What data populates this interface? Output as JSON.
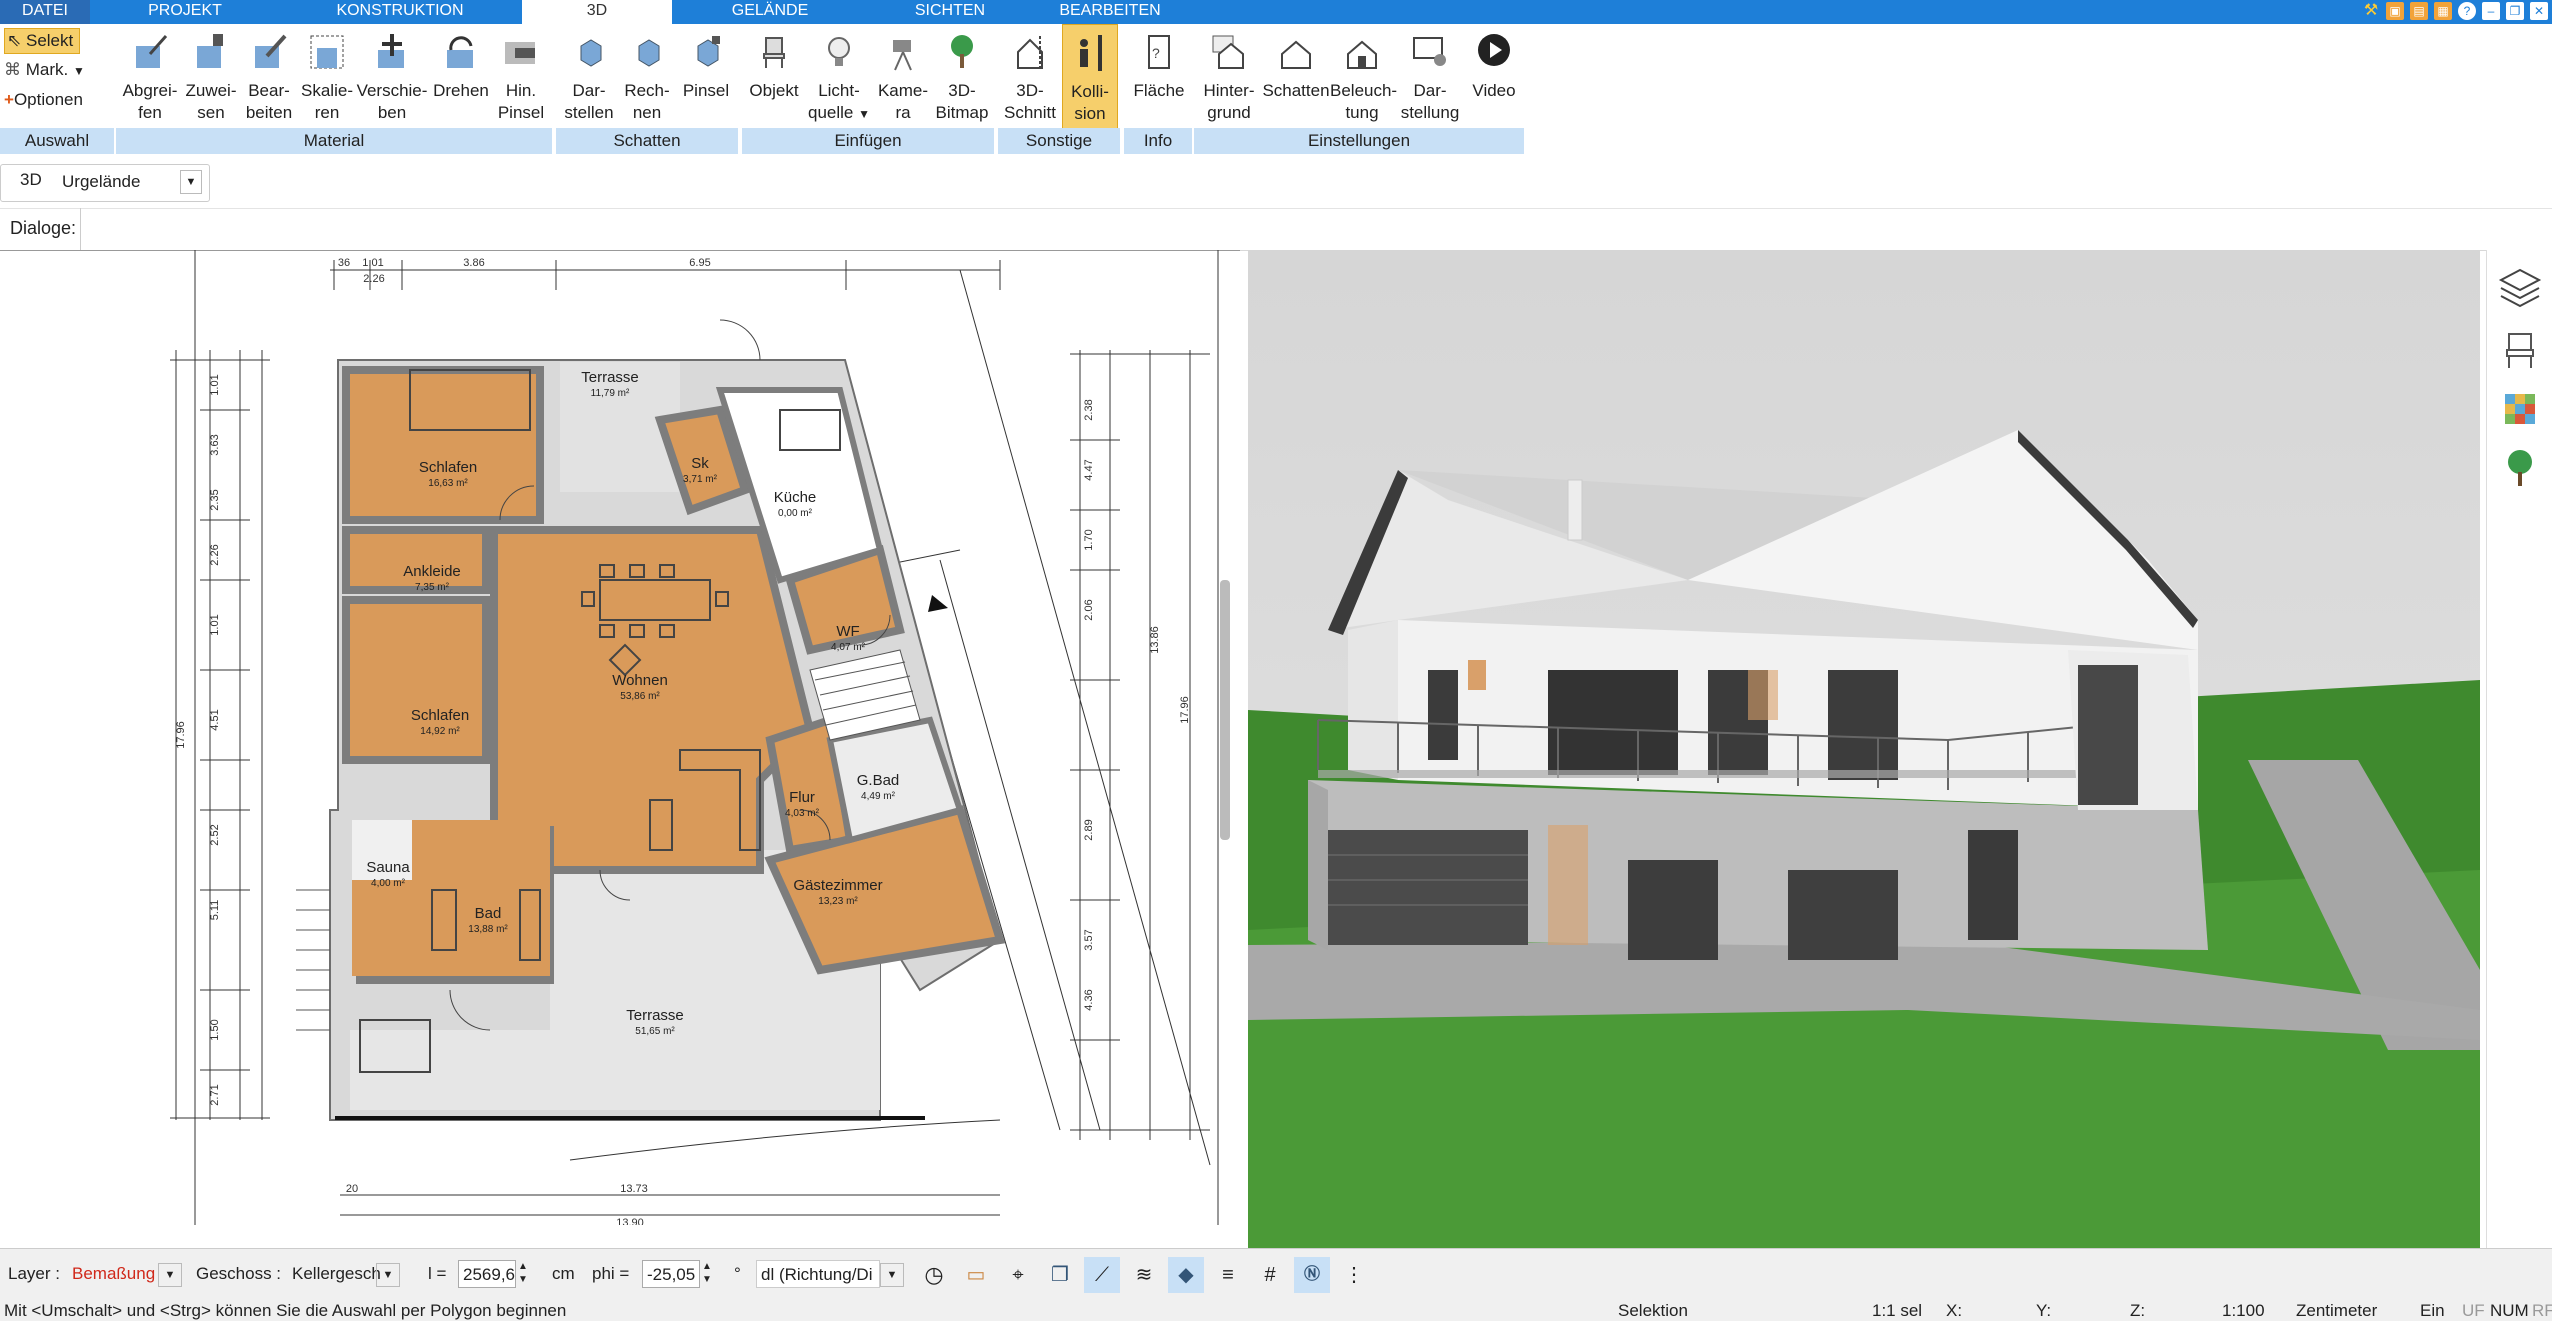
{
  "tabs": [
    {
      "label": "DATEI"
    },
    {
      "label": "PROJEKT"
    },
    {
      "label": "KONSTRUKTION"
    },
    {
      "label": "3D"
    },
    {
      "label": "GELÄNDE"
    },
    {
      "label": "SICHTEN"
    },
    {
      "label": "BEARBEITEN"
    }
  ],
  "auswahl": {
    "select": "Selekt",
    "mark": "Mark.",
    "options": "Optionen",
    "group": "Auswahl"
  },
  "ribbon": {
    "material": [
      {
        "l1": "Abgrei-",
        "l2": "fen"
      },
      {
        "l1": "Zuwei-",
        "l2": "sen"
      },
      {
        "l1": "Bear-",
        "l2": "beiten"
      },
      {
        "l1": "Skalie-",
        "l2": "ren"
      },
      {
        "l1": "Verschie-",
        "l2": "ben"
      },
      {
        "l1": "Drehen",
        "l2": ""
      },
      {
        "l1": "Hin.",
        "l2": "Pinsel"
      }
    ],
    "schatten": [
      {
        "l1": "Dar-",
        "l2": "stellen"
      },
      {
        "l1": "Rech-",
        "l2": "nen"
      },
      {
        "l1": "Pinsel",
        "l2": ""
      }
    ],
    "einfuegen": [
      {
        "l1": "Objekt",
        "l2": ""
      },
      {
        "l1": "Licht-",
        "l2": "quelle"
      },
      {
        "l1": "Kame-",
        "l2": "ra"
      },
      {
        "l1": "3D-",
        "l2": "Bitmap"
      }
    ],
    "sonstige": [
      {
        "l1": "3D-",
        "l2": "Schnitt"
      },
      {
        "l1": "Kolli-",
        "l2": "sion"
      }
    ],
    "info": [
      {
        "l1": "Fläche",
        "l2": ""
      }
    ],
    "einstellungen": [
      {
        "l1": "Hinter-",
        "l2": "grund"
      },
      {
        "l1": "Schatten",
        "l2": ""
      },
      {
        "l1": "Beleuch-",
        "l2": "tung"
      },
      {
        "l1": "Dar-",
        "l2": "stellung"
      },
      {
        "l1": "Video",
        "l2": ""
      }
    ],
    "groups": {
      "material": "Material",
      "schatten": "Schatten",
      "einfuegen": "Einfügen",
      "sonstige": "Sonstige",
      "info": "Info",
      "einstellungen": "Einstellungen"
    }
  },
  "view": {
    "mode": "3D",
    "terrain": "Urgelände",
    "dialogs_label": "Dialoge:"
  },
  "plan": {
    "rooms": [
      {
        "name": "Schlafen",
        "area": "16,63 m²"
      },
      {
        "name": "Ankleide",
        "area": "7,35 m²"
      },
      {
        "name": "Schlafen",
        "area": "14,92 m²"
      },
      {
        "name": "Wohnen",
        "area": "53,86 m²"
      },
      {
        "name": "Küche",
        "area": "0,00 m²"
      },
      {
        "name": "Sk",
        "area": "3,71 m²"
      },
      {
        "name": "Terrasse",
        "area": "11,79 m²"
      },
      {
        "name": "WF",
        "area": "4,07 m²"
      },
      {
        "name": "Flur",
        "area": "4,03 m²"
      },
      {
        "name": "G.Bad",
        "area": "4,49 m²"
      },
      {
        "name": "Gästezimmer",
        "area": "13,23 m²"
      },
      {
        "name": "Sauna",
        "area": "4,00 m²"
      },
      {
        "name": "Bad",
        "area": "13,88 m²"
      },
      {
        "name": "Terrasse",
        "area": "51,65 m²"
      }
    ],
    "dims_top": [
      "36",
      "1.01",
      "2.26",
      "3.86",
      "6.95"
    ],
    "dims_left": [
      "1.01",
      "3.63",
      "2.35",
      "2.26",
      "1.01",
      "4.51",
      "2.52",
      "5.11",
      "1.50",
      "2.71"
    ],
    "dims_right": [
      "2.38",
      "4.47",
      "1.70",
      "2.06",
      "13.86",
      "17.96",
      "2.89",
      "3.57",
      "4.36"
    ],
    "dims_bottom": [
      "13.73",
      "13.90",
      "20"
    ],
    "dim_left_total": "17.96"
  },
  "bottom": {
    "layer_label": "Layer :",
    "layer_value": "Bemaßung",
    "floor_label": "Geschoss :",
    "floor_value": "Kellergesch",
    "l_label": "l =",
    "l_value": "2569,6",
    "l_unit": "cm",
    "phi_label": "phi =",
    "phi_value": "-25,05",
    "phi_unit": "°",
    "dl_value": "dl (Richtung/Di"
  },
  "status": {
    "hint": "Mit <Umschalt> und <Strg> können Sie die Auswahl per Polygon beginnen",
    "mode": "Selektion",
    "sel": "1:1 sel",
    "x": "X:",
    "y": "Y:",
    "z": "Z:",
    "scale": "1:100",
    "unit": "Zentimeter",
    "ein": "Ein",
    "uf": "UF",
    "num": "NUM",
    "rf": "RF"
  },
  "colors": {
    "accent": "#1e7fd8",
    "group_bg": "#c8e0f6",
    "highlight": "#f6cf6b",
    "floor": "#d99a5a",
    "wall": "#8a8a8a"
  }
}
